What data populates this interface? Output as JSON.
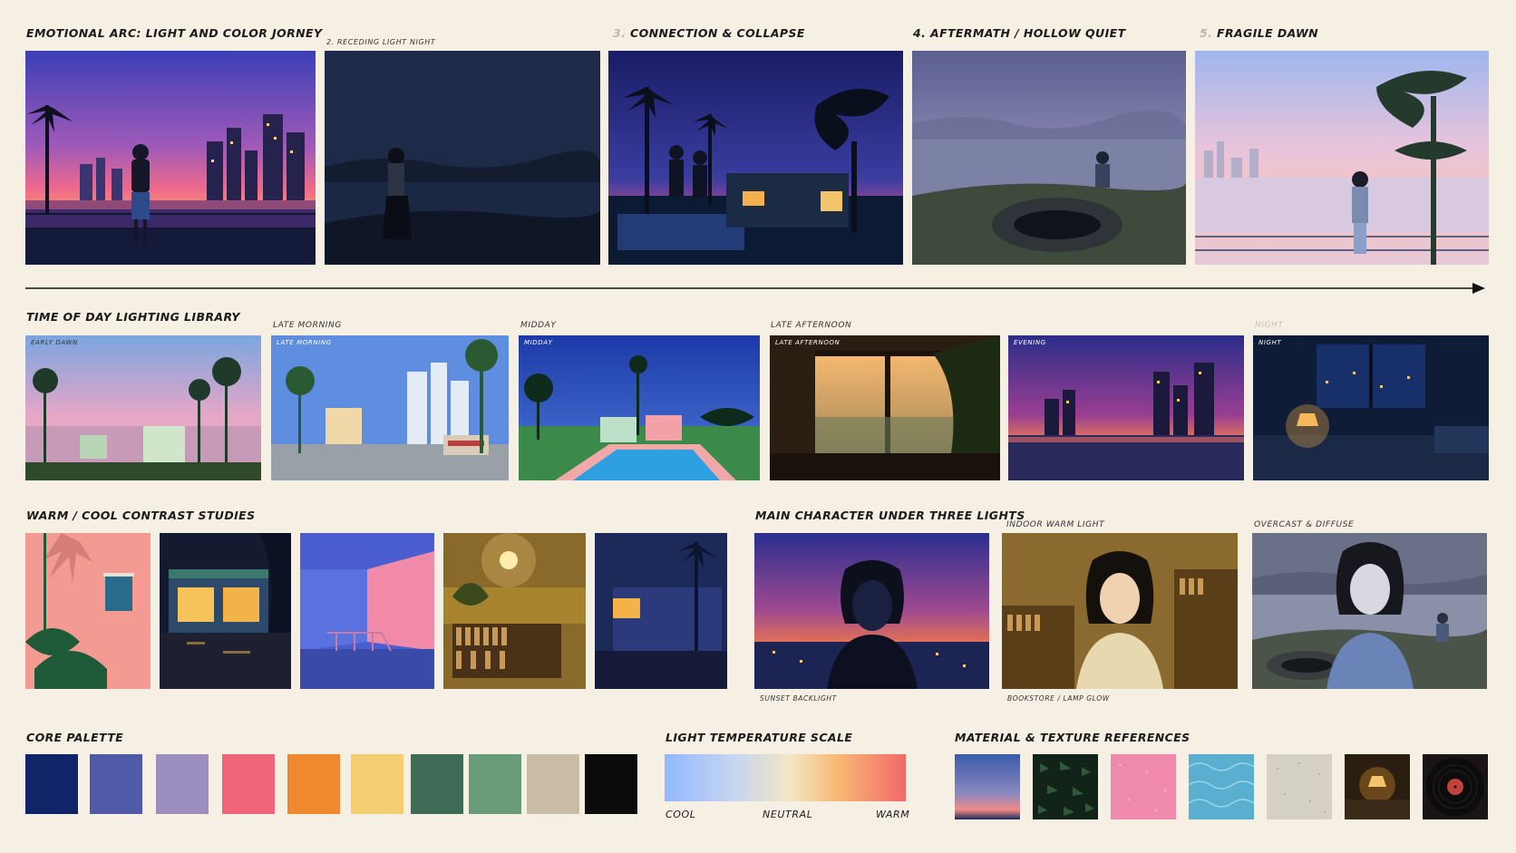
{
  "arc": {
    "heading": "Emotional Arc: Light and Color Jorney",
    "cap2": "2. Receding Light Night",
    "cap3_num": "3.",
    "cap3_text": "Connection & Collapse",
    "cap4": "4. Aftermath / Hollow Quiet",
    "cap5_num": "5.",
    "cap5_text": "Fragile Dawn"
  },
  "tod": {
    "heading": "Time of Day Lighting Library",
    "late_morning": "Late Morning",
    "midday": "Midday",
    "late_afternoon": "Late Afternoon",
    "night": "Night",
    "panel1_label": "Early Dawn",
    "panel2_label": "Late Morning",
    "panel3_label": "Midday",
    "panel4_label": "Late Afternoon",
    "panel5_label": "Evening",
    "panel6_label": "Night"
  },
  "contrast": {
    "heading": "Warm / Cool Contrast Studies"
  },
  "character": {
    "heading": "Main Character Under Three Lights",
    "cap_b": "Indoor Warm Light",
    "cap_c": "Overcast & Diffuse",
    "cap_a_bottom": "Sunset Backlight",
    "cap_b_bottom": "Bookstore / Lamp Glow"
  },
  "palette": {
    "heading": "Core Palette",
    "swatches": [
      "#0f2568",
      "#4f5aa8",
      "#9c8fc0",
      "#f0647a",
      "#f0882f",
      "#f5cd73",
      "#3f6c56",
      "#6a9c7a",
      "#c9bca4",
      "#0b0b0b"
    ]
  },
  "scale": {
    "heading": "Light Temperature Scale",
    "cool": "Cool",
    "neutral": "Neutral",
    "warm": "Warm"
  },
  "materials": {
    "heading": "Material & Texture References"
  }
}
